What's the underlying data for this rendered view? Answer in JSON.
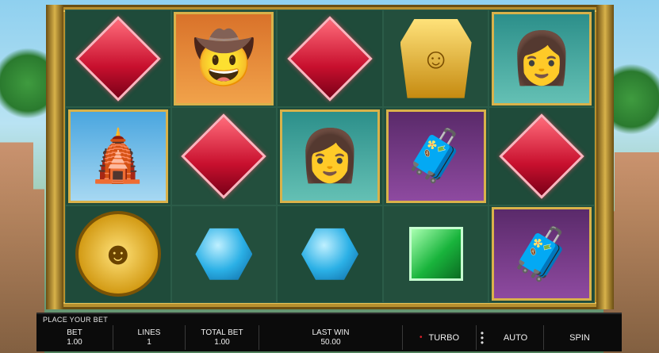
{
  "reels": [
    [
      "red-gem",
      "gold-temple",
      "gold-coin"
    ],
    [
      "explorer-man",
      "red-gem",
      "blue-gem"
    ],
    [
      "red-gem",
      "explorer-woman",
      "blue-gem"
    ],
    [
      "gold-idol",
      "porter-with-chest",
      "green-gem"
    ],
    [
      "explorer-woman",
      "red-gem",
      "porter-with-chest"
    ]
  ],
  "bar": {
    "place_label": "PLACE YOUR BET",
    "bet_label": "BET",
    "bet_value": "1.00",
    "lines_label": "LINES",
    "lines_value": "1",
    "total_label": "TOTAL BET",
    "total_value": "1.00",
    "lastwin_label": "LAST WIN",
    "lastwin_value": "50.00",
    "turbo_label": "TURBO",
    "auto_label": "AUTO",
    "spin_label": "SPIN"
  },
  "colors": {
    "reel_bg": "#1f4b3a",
    "frame_gold": "#b8902e",
    "bar_bg": "#0b0b0b",
    "turbo_indicator": "#e0202a"
  }
}
